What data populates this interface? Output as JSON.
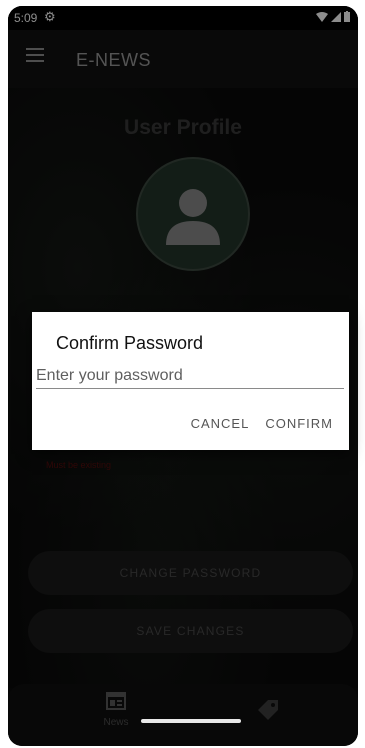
{
  "status_bar": {
    "time": "5:09"
  },
  "app_bar": {
    "title": "E-NEWS",
    "menu_icon": "hamburger-menu-icon"
  },
  "profile": {
    "title": "User Profile",
    "avatar_icon": "person-icon"
  },
  "form": {
    "error_text": "Must be existing",
    "change_password_label": "CHANGE PASSWORD",
    "save_changes_label": "SAVE CHANGES"
  },
  "dialog": {
    "title": "Confirm Password",
    "input_placeholder": "Enter your password",
    "input_value": "",
    "cancel_label": "CANCEL",
    "confirm_label": "CONFIRM"
  },
  "bottom_nav": {
    "items": [
      {
        "label": "News",
        "icon": "newspaper-icon"
      },
      {
        "label": "",
        "icon": "tag-icon"
      }
    ]
  },
  "colors": {
    "accent_avatar": "#24352a",
    "error": "#5b0f0f",
    "dialog_bg": "#ffffff"
  }
}
